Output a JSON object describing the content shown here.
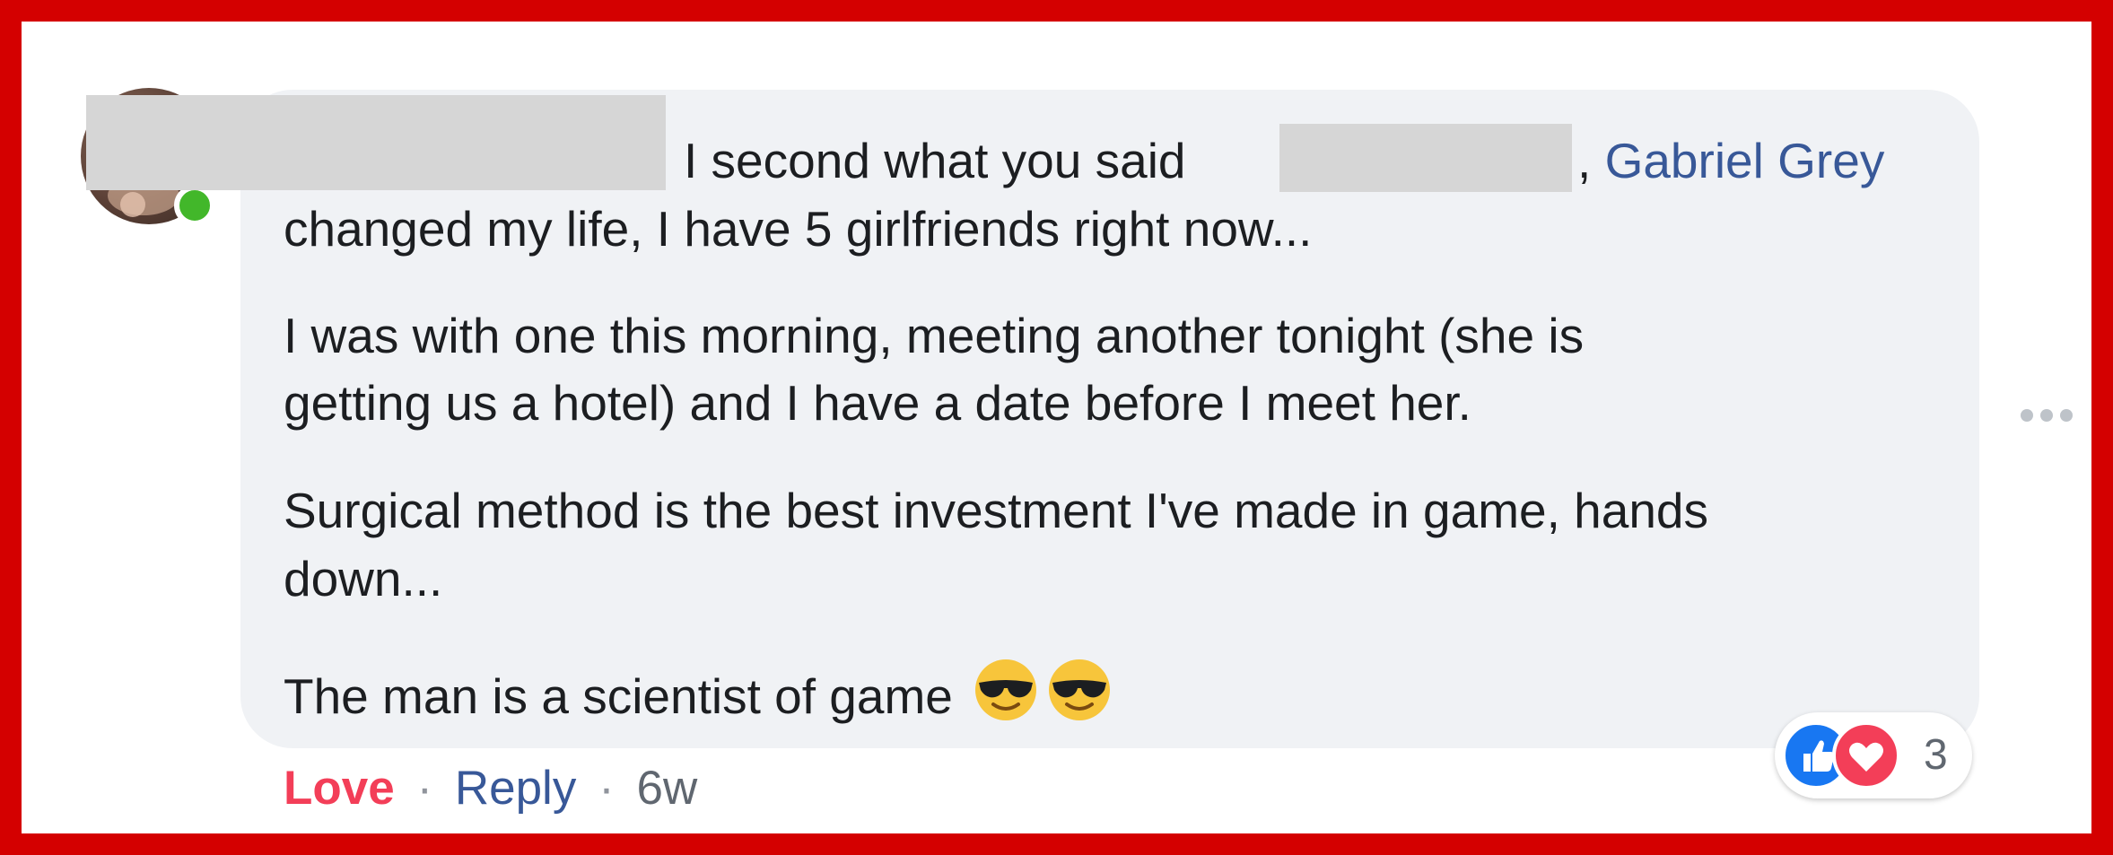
{
  "comment": {
    "line1_text": "I second what you said",
    "line1_comma": ",",
    "mention_name": "Gabriel Grey",
    "line2": "changed my life, I have 5 girlfriends right now...",
    "line3": "I was with one this morning, meeting another tonight (she is",
    "line4": "getting us a hotel) and I have a date before I meet her.",
    "line5": "Surgical method is the best investment I've made in game, hands",
    "line6": "down...",
    "line7": "The man is a scientist of game",
    "emojis": [
      "smiling-face-with-sunglasses",
      "smiling-face-with-sunglasses"
    ]
  },
  "footer": {
    "love_label": "Love",
    "separator": "·",
    "reply_label": "Reply",
    "age": "6w"
  },
  "reactions": {
    "icons": [
      "like-icon",
      "love-icon"
    ],
    "count": "3"
  },
  "colors": {
    "frame": "#d40000",
    "bubble": "#f0f2f5",
    "mention": "#385898",
    "love": "#f33e58",
    "like": "#1877f2",
    "online": "#42b72a"
  }
}
